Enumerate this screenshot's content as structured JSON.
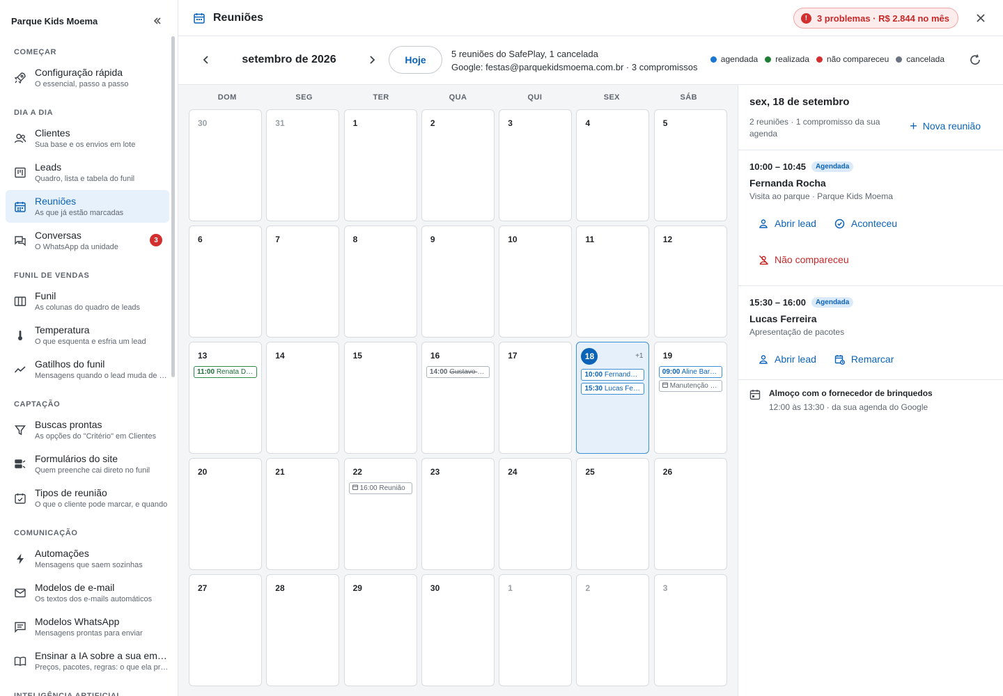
{
  "sidebar": {
    "title": "Parque Kids Moema",
    "sections": [
      {
        "title": "COMEÇAR",
        "items": [
          {
            "id": "configuracao",
            "icon": "rocket-icon",
            "label": "Configuração rápida",
            "sub": "O essencial, passo a passo"
          }
        ]
      },
      {
        "title": "DIA A DIA",
        "items": [
          {
            "id": "clientes",
            "icon": "users-icon",
            "label": "Clientes",
            "sub": "Sua base e os envios em lote"
          },
          {
            "id": "leads",
            "icon": "board-icon",
            "label": "Leads",
            "sub": "Quadro, lista e tabela do funil"
          },
          {
            "id": "reunioes",
            "icon": "calendar-icon",
            "label": "Reuniões",
            "sub": "As que já estão marcadas",
            "active": true
          },
          {
            "id": "conversas",
            "icon": "chat-icon",
            "label": "Conversas",
            "sub": "O WhatsApp da unidade",
            "badge": "3"
          }
        ]
      },
      {
        "title": "FUNIL DE VENDAS",
        "items": [
          {
            "id": "funil",
            "icon": "columns-icon",
            "label": "Funil",
            "sub": "As colunas do quadro de leads"
          },
          {
            "id": "temperatura",
            "icon": "thermometer-icon",
            "label": "Temperatura",
            "sub": "O que esquenta e esfria um lead"
          },
          {
            "id": "gatilhos",
            "icon": "trend-icon",
            "label": "Gatilhos do funil",
            "sub": "Mensagens quando o lead muda de etapa"
          }
        ]
      },
      {
        "title": "CAPTAÇÃO",
        "items": [
          {
            "id": "buscas",
            "icon": "filter-icon",
            "label": "Buscas prontas",
            "sub": "As opções do \"Critério\" em Clientes"
          },
          {
            "id": "formularios",
            "icon": "form-icon",
            "label": "Formulários do site",
            "sub": "Quem preenche cai direto no funil"
          },
          {
            "id": "tipos",
            "icon": "calendar-check-icon",
            "label": "Tipos de reunião",
            "sub": "O que o cliente pode marcar, e quando"
          }
        ]
      },
      {
        "title": "COMUNICAÇÃO",
        "items": [
          {
            "id": "automacoes",
            "icon": "bolt-icon",
            "label": "Automações",
            "sub": "Mensagens que saem sozinhas"
          },
          {
            "id": "email",
            "icon": "mail-icon",
            "label": "Modelos de e-mail",
            "sub": "Os textos dos e-mails automáticos"
          },
          {
            "id": "whatsapp",
            "icon": "message-icon",
            "label": "Modelos WhatsApp",
            "sub": "Mensagens prontas para enviar"
          },
          {
            "id": "ia",
            "icon": "book-icon",
            "label": "Ensinar a IA sobre a sua empresa",
            "sub": "Preços, pacotes, regras: o que ela precisa saber"
          }
        ]
      },
      {
        "title": "INTELIGÊNCIA ARTIFICIAL",
        "items": []
      }
    ]
  },
  "topbar": {
    "title": "Reuniões",
    "problems": "3 problemas · R$ 2.844 no mês"
  },
  "toolbar": {
    "month": "setembro de 2026",
    "today": "Hoje",
    "summary_line1": "5 reuniões do SafePlay, 1 cancelada",
    "summary_line2": "Google: festas@parquekidsmoema.com.br · 3 compromissos",
    "legend": [
      {
        "label": "agendada",
        "color": "#1976d2"
      },
      {
        "label": "realizada",
        "color": "#1e7e34"
      },
      {
        "label": "não compareceu",
        "color": "#d32f2f"
      },
      {
        "label": "cancelada",
        "color": "#6b7280"
      }
    ]
  },
  "calendar": {
    "weekdays": [
      "DOM",
      "SEG",
      "TER",
      "QUA",
      "QUI",
      "SEX",
      "SÁB"
    ],
    "weeks": [
      [
        {
          "n": "30",
          "muted": true
        },
        {
          "n": "31",
          "muted": true
        },
        {
          "n": "1"
        },
        {
          "n": "2"
        },
        {
          "n": "3"
        },
        {
          "n": "4"
        },
        {
          "n": "5"
        }
      ],
      [
        {
          "n": "6"
        },
        {
          "n": "7"
        },
        {
          "n": "8"
        },
        {
          "n": "9"
        },
        {
          "n": "10"
        },
        {
          "n": "11"
        },
        {
          "n": "12"
        }
      ],
      [
        {
          "n": "13",
          "events": [
            {
              "kind": "green",
              "time": "11:00",
              "name": "Renata Dias"
            }
          ]
        },
        {
          "n": "14"
        },
        {
          "n": "15"
        },
        {
          "n": "16",
          "events": [
            {
              "kind": "grey",
              "cancel": true,
              "time": "14:00",
              "name": "Gustavo Nunes"
            }
          ]
        },
        {
          "n": "17"
        },
        {
          "n": "18",
          "selected": true,
          "more": "+1",
          "events": [
            {
              "kind": "blue",
              "time": "10:00",
              "name": "Fernanda Rocha"
            },
            {
              "kind": "blue",
              "time": "15:30",
              "name": "Lucas Ferreira"
            }
          ]
        },
        {
          "n": "19",
          "events": [
            {
              "kind": "blue",
              "time": "09:00",
              "name": "Aline Barbosa"
            },
            {
              "kind": "grey",
              "gcal": true,
              "name": "Manutenção dos brinquedos"
            }
          ]
        }
      ],
      [
        {
          "n": "20"
        },
        {
          "n": "21"
        },
        {
          "n": "22",
          "events": [
            {
              "kind": "grey",
              "gcal": true,
              "name": "16:00 Reunião"
            }
          ]
        },
        {
          "n": "23"
        },
        {
          "n": "24"
        },
        {
          "n": "25"
        },
        {
          "n": "26"
        }
      ],
      [
        {
          "n": "27"
        },
        {
          "n": "28"
        },
        {
          "n": "29"
        },
        {
          "n": "30"
        },
        {
          "n": "1",
          "muted": true
        },
        {
          "n": "2",
          "muted": true
        },
        {
          "n": "3",
          "muted": true
        }
      ]
    ]
  },
  "panel": {
    "date": "sex, 18 de setembro",
    "count": "2 reuniões · 1 compromisso da sua agenda",
    "new_meeting": "Nova reunião",
    "meetings": [
      {
        "time": "10:00 – 10:45",
        "status": "Agendada",
        "name": "Fernanda Rocha",
        "desc": "Visita ao parque · Parque Kids Moema",
        "actions": [
          {
            "icon": "user-icon",
            "label": "Abrir lead"
          },
          {
            "icon": "check-circle-icon",
            "label": "Aconteceu"
          },
          {
            "icon": "user-off-icon",
            "label": "Não compareceu",
            "red": true
          }
        ]
      },
      {
        "time": "15:30 – 16:00",
        "status": "Agendada",
        "name": "Lucas Ferreira",
        "desc": "Apresentação de pacotes",
        "actions": [
          {
            "icon": "user-icon",
            "label": "Abrir lead"
          },
          {
            "icon": "reschedule-icon",
            "label": "Remarcar"
          }
        ]
      }
    ],
    "gcal": {
      "title": "Almoço com o fornecedor de brinquedos",
      "sub": "12:00 às 13:30 · da sua agenda do Google"
    }
  }
}
